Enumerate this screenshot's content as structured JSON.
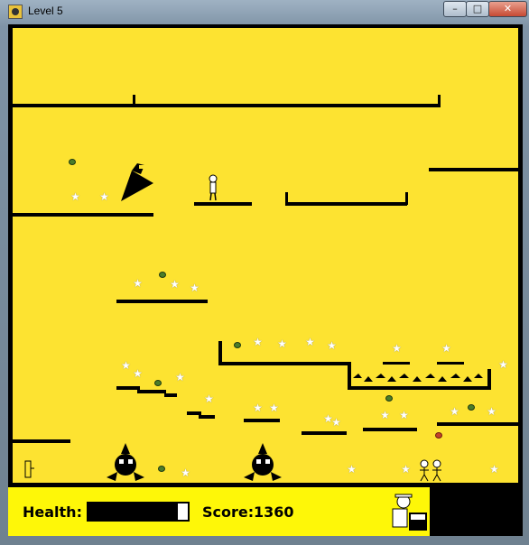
{
  "window": {
    "title": "Level 5"
  },
  "controls": {
    "minimize": "–",
    "maximize": "□",
    "close": "✕"
  },
  "hud": {
    "health_label": "Health:",
    "health_value": 0.9,
    "score_label": "Score:",
    "score": "1360"
  },
  "colors": {
    "field": "#fde331",
    "hud": "#fef708",
    "platform": "#000000"
  },
  "icons": {
    "star": "star-icon",
    "gem": "gem-icon",
    "enemy": "spiked-enemy-icon",
    "player": "player-icon"
  }
}
